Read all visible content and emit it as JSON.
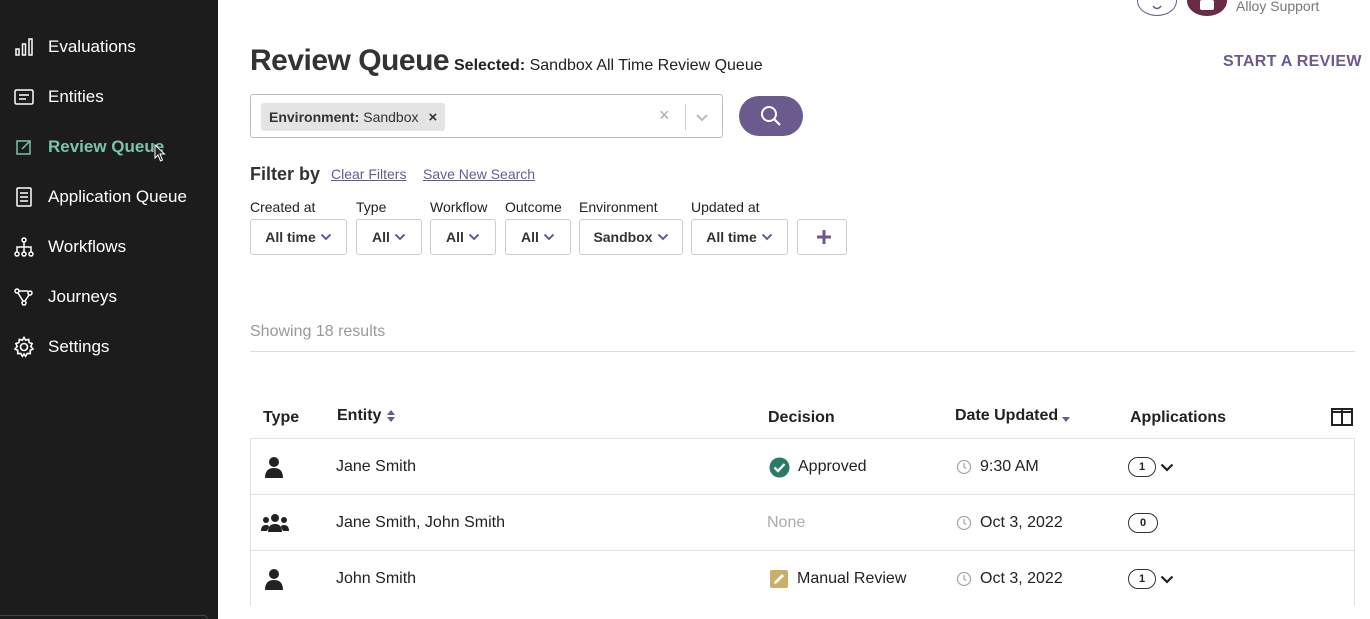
{
  "sidebar": {
    "items": [
      {
        "label": "Evaluations",
        "icon": "bar-chart-icon",
        "active": false
      },
      {
        "label": "Entities",
        "icon": "id-card-icon",
        "active": false
      },
      {
        "label": "Review Queue",
        "icon": "edit-square-icon",
        "active": true
      },
      {
        "label": "Application Queue",
        "icon": "document-list-icon",
        "active": false
      },
      {
        "label": "Workflows",
        "icon": "workflow-tree-icon",
        "active": false
      },
      {
        "label": "Journeys",
        "icon": "journey-path-icon",
        "active": false
      },
      {
        "label": "Settings",
        "icon": "gear-icon",
        "active": false
      }
    ]
  },
  "header": {
    "title": "Review Queue",
    "selected_label": "Selected:",
    "selected_value": "Sandbox All Time Review Queue",
    "start_review": "START A REVIEW",
    "user_name": "Alloy Support"
  },
  "search": {
    "chip_key": "Environment:",
    "chip_value": "Sandbox",
    "chip_remove": "×",
    "clear": "×"
  },
  "filters": {
    "title": "Filter by",
    "clear_link": "Clear Filters",
    "save_link": "Save New Search",
    "items": [
      {
        "label": "Created at",
        "value": "All time"
      },
      {
        "label": "Type",
        "value": "All"
      },
      {
        "label": "Workflow",
        "value": "All"
      },
      {
        "label": "Outcome",
        "value": "All"
      },
      {
        "label": "Environment",
        "value": "Sandbox"
      },
      {
        "label": "Updated at",
        "value": "All time"
      }
    ],
    "add_label": "+"
  },
  "results": {
    "showing": "Showing 18 results"
  },
  "table": {
    "columns": {
      "type": "Type",
      "entity": "Entity",
      "decision": "Decision",
      "date_updated": "Date Updated",
      "applications": "Applications"
    },
    "rows": [
      {
        "type_icon": "person-icon",
        "entity": "Jane Smith",
        "decision": "Approved",
        "decision_icon": "check-circle-icon",
        "date": "9:30 AM",
        "applications": "1",
        "expandable": true
      },
      {
        "type_icon": "group-icon",
        "entity": "Jane Smith, John Smith",
        "decision": "None",
        "decision_icon": "",
        "date": "Oct 3, 2022",
        "applications": "0",
        "expandable": false
      },
      {
        "type_icon": "person-icon",
        "entity": "John Smith",
        "decision": "Manual Review",
        "decision_icon": "pencil-square-icon",
        "date": "Oct 3, 2022",
        "applications": "1",
        "expandable": true
      }
    ]
  },
  "colors": {
    "sidebar_bg": "#1c1c1c",
    "active_nav": "#7cc4a8",
    "accent": "#6b5a8e",
    "approved": "#2a7a6a",
    "manual_review": "#c9b06a"
  }
}
